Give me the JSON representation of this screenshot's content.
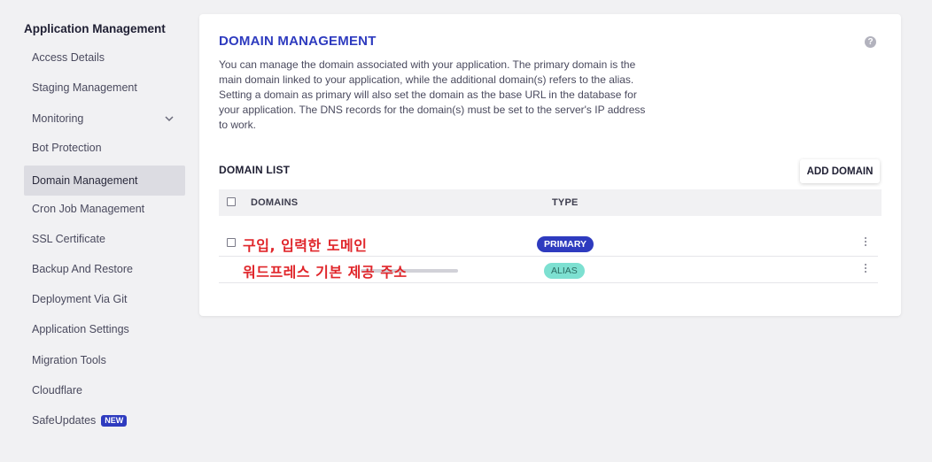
{
  "sidebar": {
    "title": "Application Management",
    "items": [
      {
        "label": "Access Details"
      },
      {
        "label": "Staging Management"
      },
      {
        "label": "Monitoring"
      },
      {
        "label": "Bot Protection"
      },
      {
        "label": "Domain Management"
      },
      {
        "label": "Cron Job Management"
      },
      {
        "label": "SSL Certificate"
      },
      {
        "label": "Backup And Restore"
      },
      {
        "label": "Deployment Via Git"
      },
      {
        "label": "Application Settings"
      },
      {
        "label": "Migration Tools"
      },
      {
        "label": "Cloudflare"
      },
      {
        "label": "SafeUpdates",
        "badge": "NEW"
      }
    ],
    "active_item": "Domain Management"
  },
  "main": {
    "title": "DOMAIN MANAGEMENT",
    "help_icon": "?",
    "description": "You can manage the domain associated with your application. The primary domain is the main domain linked to your application, while the additional domain(s) refers to the alias. Setting a domain as primary will also set the domain as the base URL in the database for your application. The DNS records for the domain(s) must be set to the server's IP address to work.",
    "domain_list": {
      "title": "DOMAIN LIST",
      "add_button": "ADD DOMAIN",
      "columns": {
        "domains": "DOMAINS",
        "type": "TYPE"
      },
      "rows": [
        {
          "domain": "구입, 입력한 도메인",
          "type": "PRIMARY"
        },
        {
          "domain": "워드프레스 기본 제공 주소",
          "type": "ALIAS"
        }
      ]
    }
  },
  "colors": {
    "accent": "#2e3bbf",
    "alias_badge": "#7de0d1",
    "annotation_red": "#e0262b",
    "background": "#f1f1f3"
  }
}
